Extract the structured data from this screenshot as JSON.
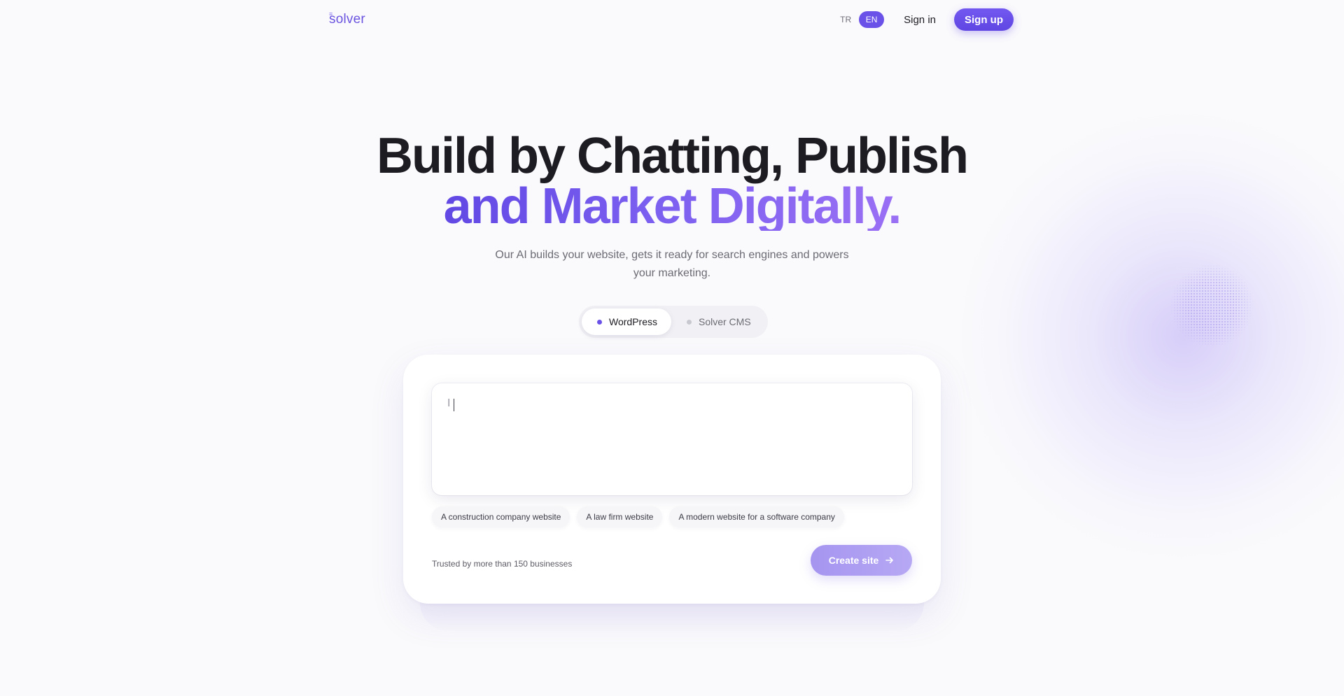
{
  "header": {
    "logo_text": "solver",
    "logo_mark": "≡",
    "languages": [
      {
        "code": "TR",
        "active": false
      },
      {
        "code": "EN",
        "active": true
      }
    ],
    "signin_label": "Sign in",
    "signup_label": "Sign up"
  },
  "hero": {
    "title_line1": "Build by Chatting, Publish",
    "title_line2": "and Market Digitally.",
    "subtitle": "Our AI builds your website, gets it ready for search engines and powers your marketing."
  },
  "platform_toggle": {
    "options": [
      {
        "label": "WordPress",
        "active": true
      },
      {
        "label": "Solver CMS",
        "active": false
      }
    ]
  },
  "prompt": {
    "value": "",
    "placeholder_glyph": "I"
  },
  "suggestions": [
    "A construction company website",
    "A law firm website",
    "A modern website for a software company"
  ],
  "footer": {
    "trusted_text": "Trusted by more than 150 businesses",
    "create_label": "Create site"
  },
  "colors": {
    "accent": "#6a52e8",
    "title_gradient": [
      "#6248e4",
      "#9a70f4"
    ],
    "create_button": "#a695f0"
  },
  "icons": {
    "create_button_icon": "arrow-right-icon"
  }
}
